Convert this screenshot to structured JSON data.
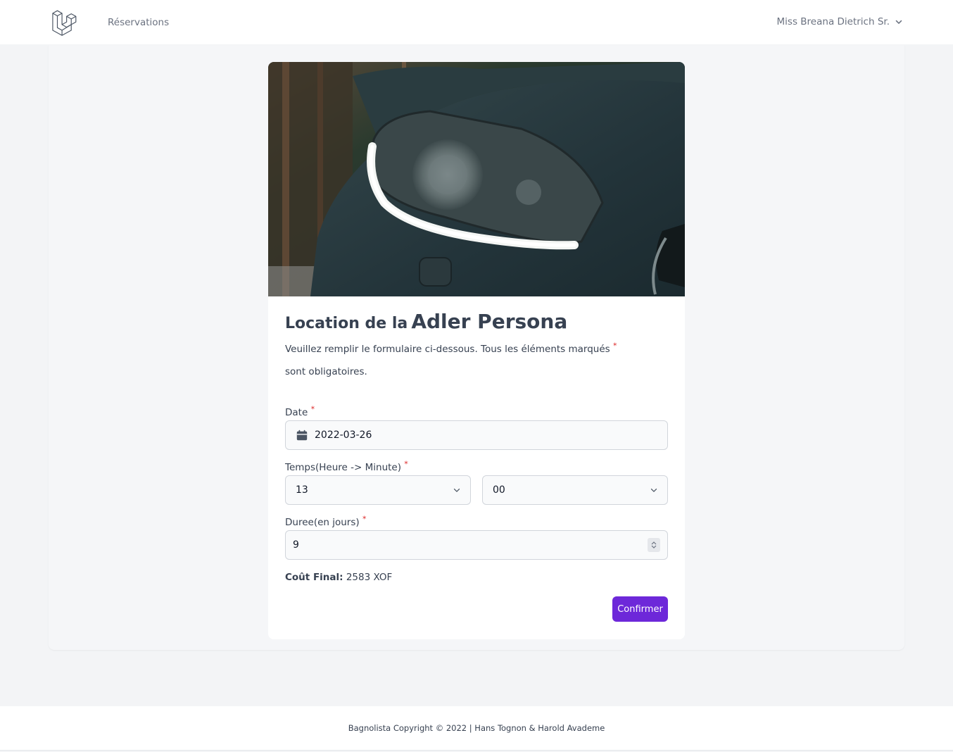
{
  "nav": {
    "logo_icon": "laravel-logo-icon",
    "link_reservations": "Réservations",
    "user_name": "Miss Breana Dietrich Sr.",
    "user_menu_icon": "chevron-down-icon"
  },
  "card": {
    "hero_image": "car-headlight-photo",
    "title_prefix": "Location de la",
    "car_name": "Adler Persona",
    "intro_text_1": "Veuillez remplir le formulaire ci-dessous. Tous les éléments marqués",
    "required_mark": "*",
    "intro_text_2": "sont obligatoires."
  },
  "form": {
    "date_label": "Date",
    "date_value": "2022-03-26",
    "time_label": "Temps(Heure -> Minute)",
    "hour_value": "13",
    "minute_value": "00",
    "duration_label": "Duree(en jours)",
    "duration_value": "9",
    "cost_label": "Coût Final:",
    "cost_value": "2583 XOF",
    "confirm_label": "Confirmer"
  },
  "footer": {
    "text": "Bagnolista Copyright © 2022 | Hans Tognon & Harold Avademe"
  },
  "colors": {
    "accent": "#6d28d9",
    "required": "#dc2626",
    "background": "#f3f4f6"
  }
}
